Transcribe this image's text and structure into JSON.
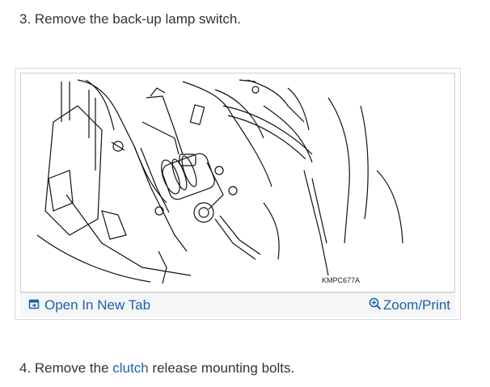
{
  "step3": {
    "text": "3. Remove the back-up lamp switch."
  },
  "figure": {
    "code": "KMPC677A",
    "open_tab_label": "Open In New Tab",
    "zoom_label": "Zoom/Print",
    "open_tab_icon": "open-in-new-tab-icon",
    "zoom_icon": "magnifier-plus-icon"
  },
  "step4": {
    "prefix": "4. Remove the ",
    "link": "clutch",
    "suffix": " release mounting bolts."
  },
  "colors": {
    "link": "#1f5fa8",
    "text": "#333333",
    "toolbar_bg": "#f4f6f8"
  }
}
